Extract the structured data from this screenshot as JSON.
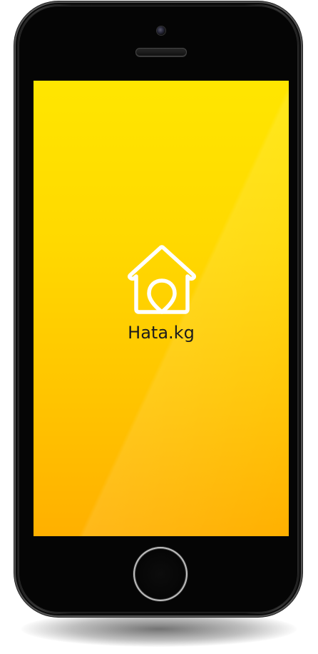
{
  "app": {
    "name": "Hata.kg"
  },
  "icons": {
    "logo": "house-pin-icon"
  },
  "colors": {
    "screen_top": "#ffe600",
    "screen_bottom": "#ffb000",
    "logo_stroke": "#ffffff",
    "text": "#1c1c1c",
    "device_body": "#0d0d0d"
  }
}
